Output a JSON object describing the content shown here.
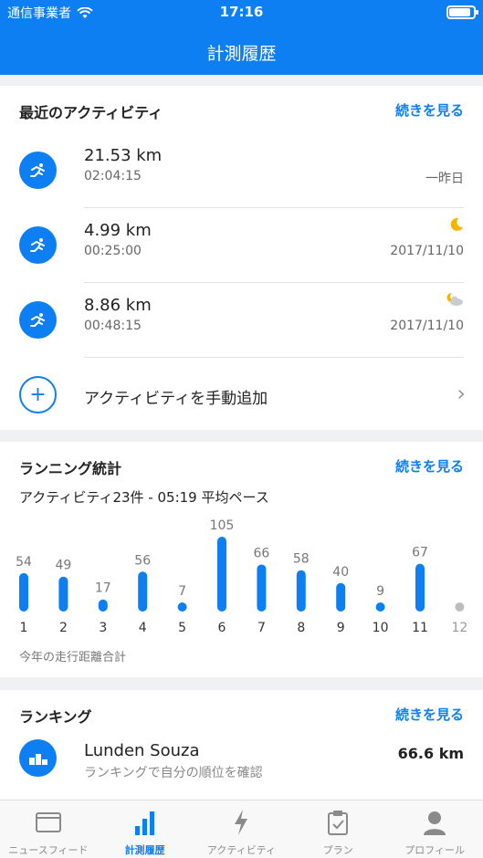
{
  "status_bar": {
    "carrier": "通信事業者",
    "time": "17:16",
    "battery_level": 0.9
  },
  "header": {
    "title": "計測履歴"
  },
  "recent": {
    "title": "最近のアクティビティ",
    "more_label": "続きを見る",
    "items": [
      {
        "distance": "21.53 km",
        "duration": "02:04:15",
        "date": "一昨日",
        "weather_icon": ""
      },
      {
        "distance": "4.99 km",
        "duration": "00:25:00",
        "date": "2017/11/10",
        "weather_icon": "moon-icon"
      },
      {
        "distance": "8.86 km",
        "duration": "00:48:15",
        "date": "2017/11/10",
        "weather_icon": "cloud-moon-icon"
      }
    ],
    "add_label": "アクティビティを手動追加"
  },
  "stats": {
    "title": "ランニング統計",
    "more_label": "続きを見る",
    "summary": "アクティビティ23件 - 05:19 平均ペース",
    "caption": "今年の走行距離合計",
    "chart_data": {
      "type": "bar",
      "categories": [
        "1",
        "2",
        "3",
        "4",
        "5",
        "6",
        "7",
        "8",
        "9",
        "10",
        "11",
        "12"
      ],
      "values": [
        54,
        49,
        17,
        56,
        7,
        105,
        66,
        58,
        40,
        9,
        67,
        null
      ],
      "value_labels": [
        "54",
        "49",
        "17",
        "56",
        "7",
        "105",
        "66",
        "58",
        "40",
        "9",
        "67",
        ""
      ],
      "bar_color": "#0d7ff2",
      "inactive_color": "#bdbdbd",
      "title": "",
      "xlabel": "",
      "ylabel": ""
    }
  },
  "ranking": {
    "title": "ランキング",
    "more_label": "続きを見る",
    "name": "Lunden Souza",
    "subtitle": "ランキングで自分の順位を確認",
    "distance": "66.6 km"
  },
  "tabs": [
    {
      "label": "ニュースフィード",
      "icon": "newsfeed-icon",
      "active": false
    },
    {
      "label": "計測履歴",
      "icon": "history-icon",
      "active": true
    },
    {
      "label": "アクティビティ",
      "icon": "bolt-icon",
      "active": false
    },
    {
      "label": "プラン",
      "icon": "plan-icon",
      "active": false
    },
    {
      "label": "プロフィール",
      "icon": "profile-icon",
      "active": false
    }
  ],
  "colors": {
    "accent": "#0d7ff2",
    "background": "#f0f1f3"
  }
}
